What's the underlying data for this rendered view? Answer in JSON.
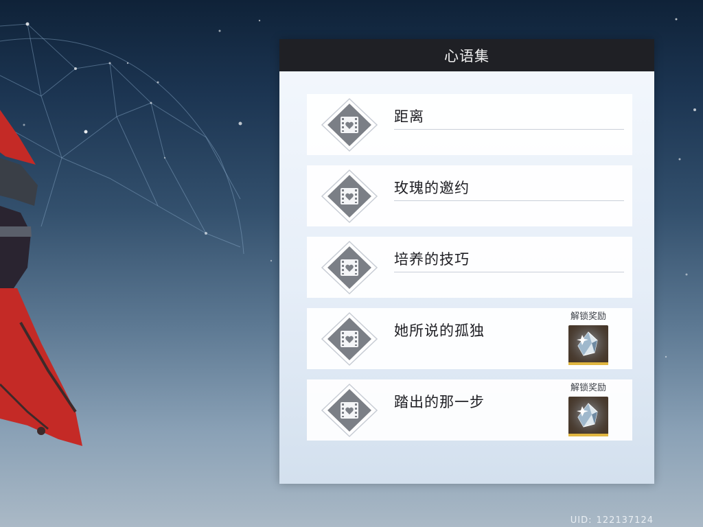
{
  "panel": {
    "title": "心语集"
  },
  "entries": [
    {
      "title": "距离",
      "has_reward": false,
      "reward_label": ""
    },
    {
      "title": "玫瑰的邀约",
      "has_reward": false,
      "reward_label": ""
    },
    {
      "title": "培养的技巧",
      "has_reward": false,
      "reward_label": ""
    },
    {
      "title": "她所说的孤独",
      "has_reward": true,
      "reward_label": "解锁奖励"
    },
    {
      "title": "踏出的那一步",
      "has_reward": true,
      "reward_label": "解锁奖励"
    }
  ],
  "footer": {
    "uid_label": "UID:",
    "uid_value": "122137124"
  },
  "icons": {
    "entry": "film-heart-diamond-icon",
    "reward": "crystal-reward-icon"
  },
  "colors": {
    "panel_header_bg": "#1f2025",
    "accent_gold": "#e0b640",
    "cape_red": "#c42a26"
  }
}
